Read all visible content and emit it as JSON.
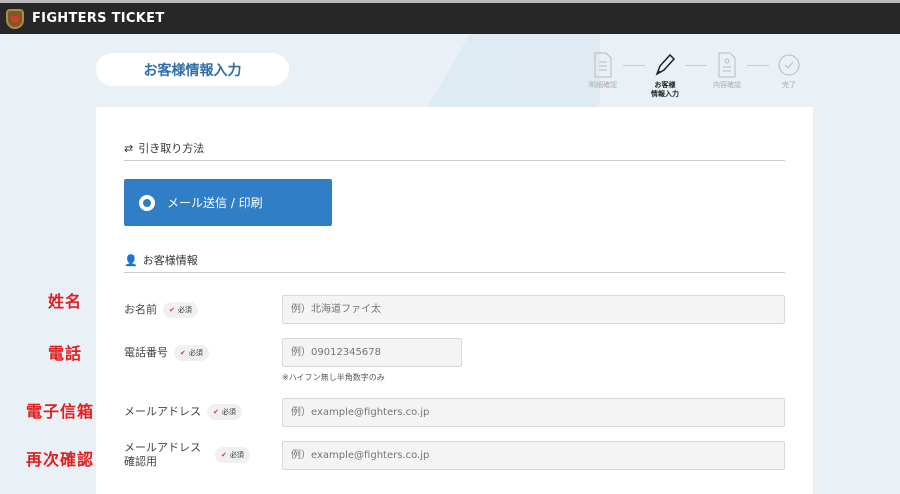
{
  "header": {
    "brand": "FIGHTERS TICKET"
  },
  "page_title": "お客様情報入力",
  "steps": [
    {
      "label": "明細確認"
    },
    {
      "label": "お客様\n情報入力",
      "active": true
    },
    {
      "label": "内容確認"
    },
    {
      "label": "完了"
    }
  ],
  "pickup": {
    "heading": "引き取り方法",
    "option": "メール送信 / 印刷"
  },
  "customer": {
    "heading": "お客様情報",
    "required": "必須",
    "fields": [
      {
        "label": "お名前",
        "placeholder": "例）北海道ファイ太"
      },
      {
        "label": "電話番号",
        "placeholder": "例）09012345678",
        "note": "※ハイフン無し半角数字のみ"
      },
      {
        "label": "メールアドレス",
        "placeholder": "例）example@fighters.co.jp"
      },
      {
        "label": "メールアドレス\n確認用",
        "placeholder": "例）example@fighters.co.jp"
      }
    ]
  },
  "annotations": [
    "姓名",
    "電話",
    "電子信箱",
    "再次確認"
  ],
  "colors": {
    "accent": "#2f7ec6",
    "title": "#2f6fa7",
    "annotation": "#e02020"
  }
}
